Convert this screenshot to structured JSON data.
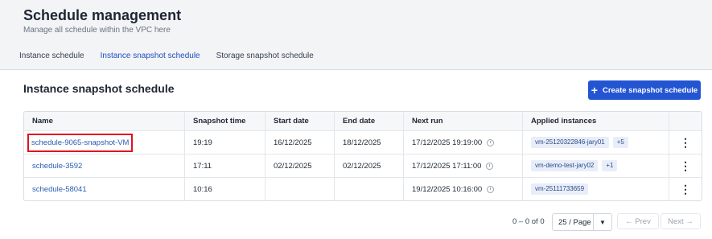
{
  "header": {
    "title": "Schedule management",
    "subtitle": "Manage all schedule within the VPC here"
  },
  "tabs": [
    {
      "label": "Instance schedule",
      "active": false
    },
    {
      "label": "Instance snapshot schedule",
      "active": true
    },
    {
      "label": "Storage snapshot schedule",
      "active": false
    }
  ],
  "section": {
    "title": "Instance snapshot schedule",
    "create_button": "Create snapshot schedule"
  },
  "table": {
    "columns": [
      "Name",
      "Snapshot time",
      "Start date",
      "End date",
      "Next run",
      "Applied instances"
    ],
    "rows": [
      {
        "name": "schedule-9065-snapshot-VM",
        "time": "19:19",
        "start": "16/12/2025",
        "end": "18/12/2025",
        "next_run": "17/12/2025 19:19:00",
        "instance": "vm-25120322846-jary01",
        "extra": "+5"
      },
      {
        "name": "schedule-3592",
        "time": "17:11",
        "start": "02/12/2025",
        "end": "02/12/2025",
        "next_run": "17/12/2025 17:11:00",
        "instance": "vm-demo-test-jary02",
        "extra": "+1"
      },
      {
        "name": "schedule-58041",
        "time": "10:16",
        "start": "",
        "end": "",
        "next_run": "19/12/2025 10:16:00",
        "instance": "vm-25111733659",
        "extra": ""
      }
    ]
  },
  "pagination": {
    "count": "0 – 0 of 0",
    "per_page": "25 / Page",
    "prev": "Prev",
    "next": "Next"
  },
  "colors": {
    "accent": "#2355d3",
    "highlight": "#e0111f",
    "link": "#2a5db0"
  }
}
